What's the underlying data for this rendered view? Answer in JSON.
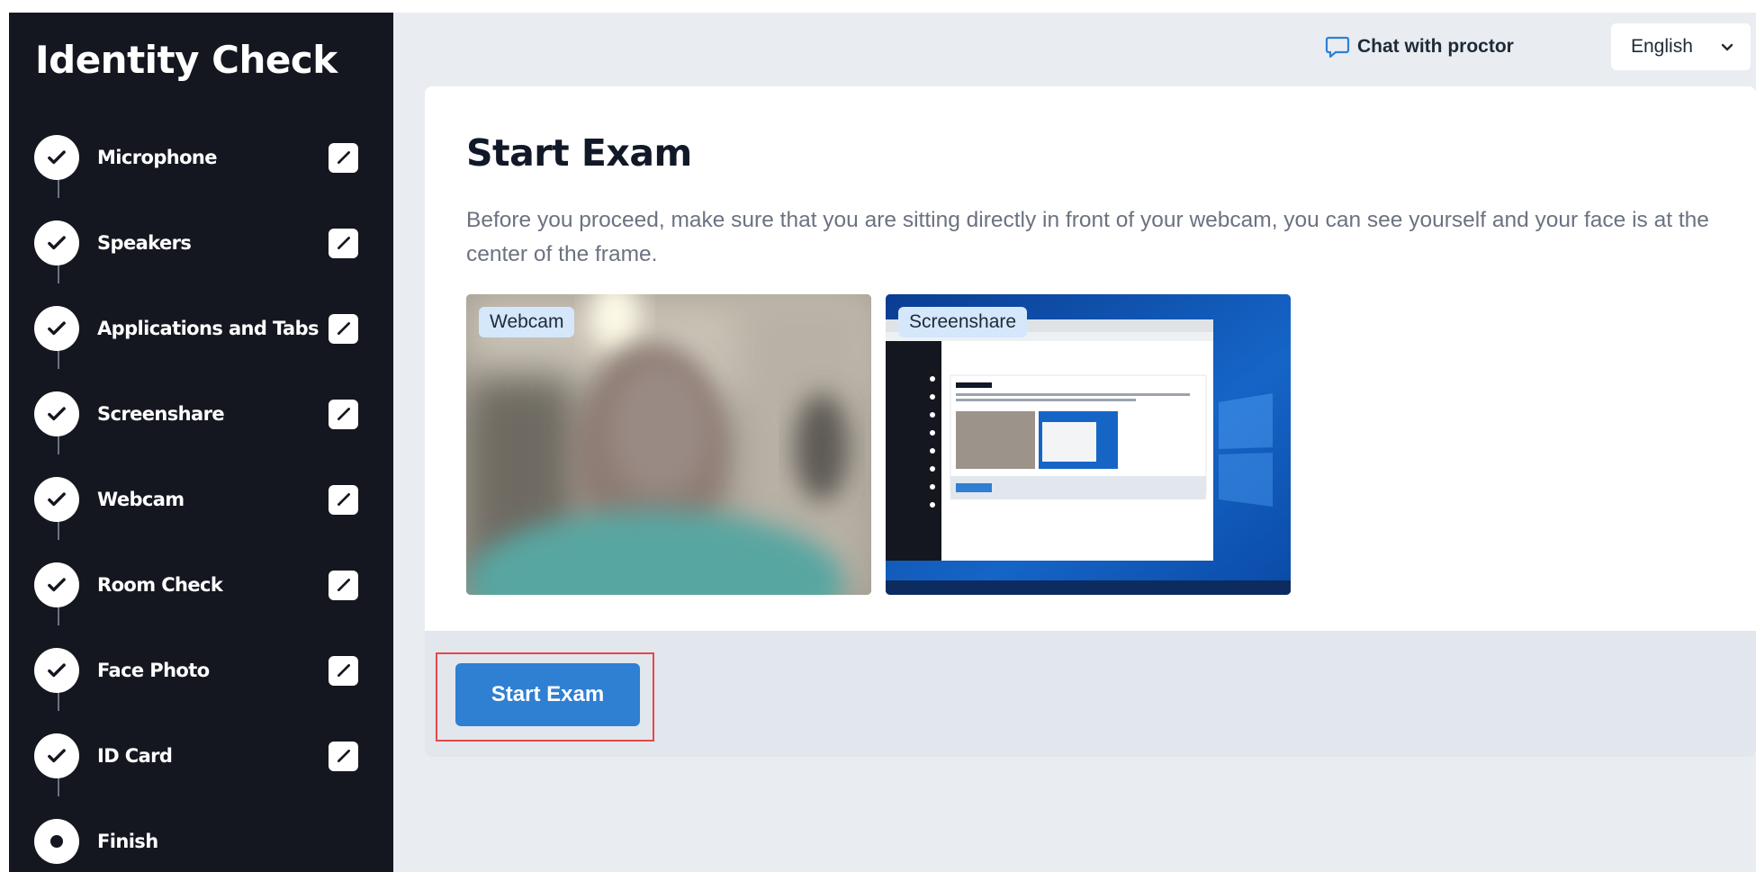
{
  "sidebar": {
    "title": "Identity Check",
    "steps": [
      {
        "label": "Microphone",
        "status": "done"
      },
      {
        "label": "Speakers",
        "status": "done"
      },
      {
        "label": "Applications and Tabs",
        "status": "done"
      },
      {
        "label": "Screenshare",
        "status": "done"
      },
      {
        "label": "Webcam",
        "status": "done"
      },
      {
        "label": "Room Check",
        "status": "done"
      },
      {
        "label": "Face Photo",
        "status": "done"
      },
      {
        "label": "ID Card",
        "status": "done"
      },
      {
        "label": "Finish",
        "status": "current"
      }
    ]
  },
  "header": {
    "chat_label": "Chat with proctor",
    "language": "English"
  },
  "main": {
    "title": "Start Exam",
    "description": "Before you proceed, make sure that you are sitting directly in front of your webcam, you can see yourself and your face is at the center of the frame.",
    "webcam_label": "Webcam",
    "screenshare_label": "Screenshare",
    "start_button": "Start Exam"
  },
  "colors": {
    "sidebar_bg": "#14171f",
    "accent": "#2f7fd3",
    "badge_bg": "#d4e7fb",
    "highlight": "#e5484d"
  }
}
